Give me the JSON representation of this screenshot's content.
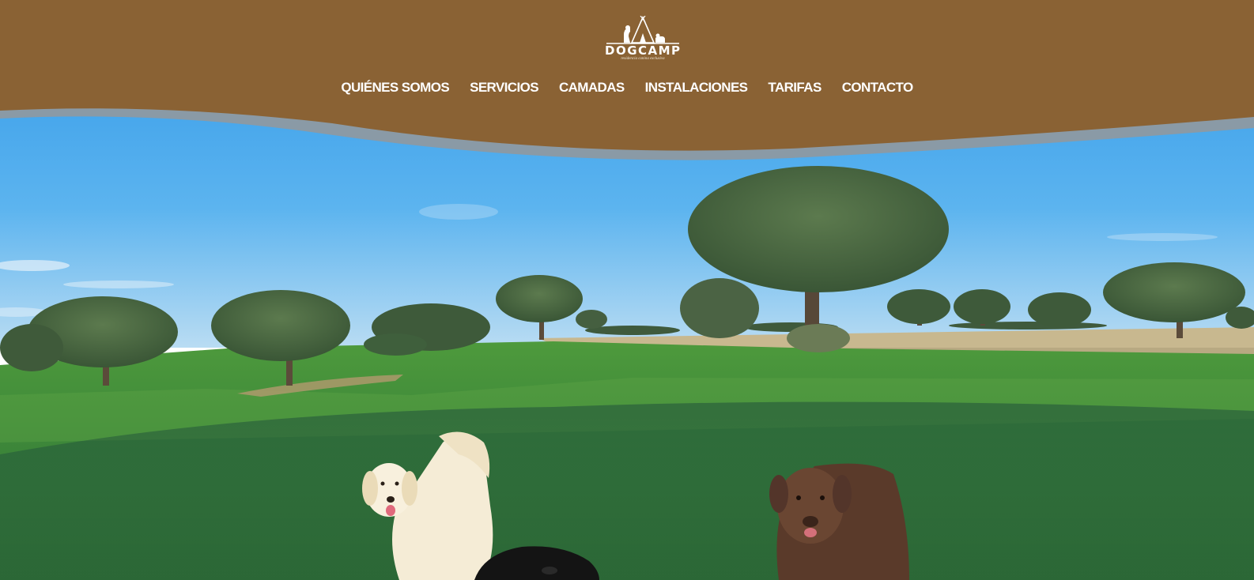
{
  "brand": {
    "name": "DOGCAMP",
    "tagline": "residencia canina exclusiva",
    "header_color": "#8a6234",
    "wave_color": "#8a9aa6"
  },
  "nav": {
    "items": [
      {
        "label": "QUIÉNES SOMOS"
      },
      {
        "label": "SERVICIOS"
      },
      {
        "label": "CAMADAS"
      },
      {
        "label": "INSTALACIONES"
      },
      {
        "label": "TARIFAS"
      },
      {
        "label": "CONTACTO"
      }
    ]
  },
  "hero": {
    "sky_color": "#3aa2ea",
    "grass_color": "#3f8f3a"
  }
}
